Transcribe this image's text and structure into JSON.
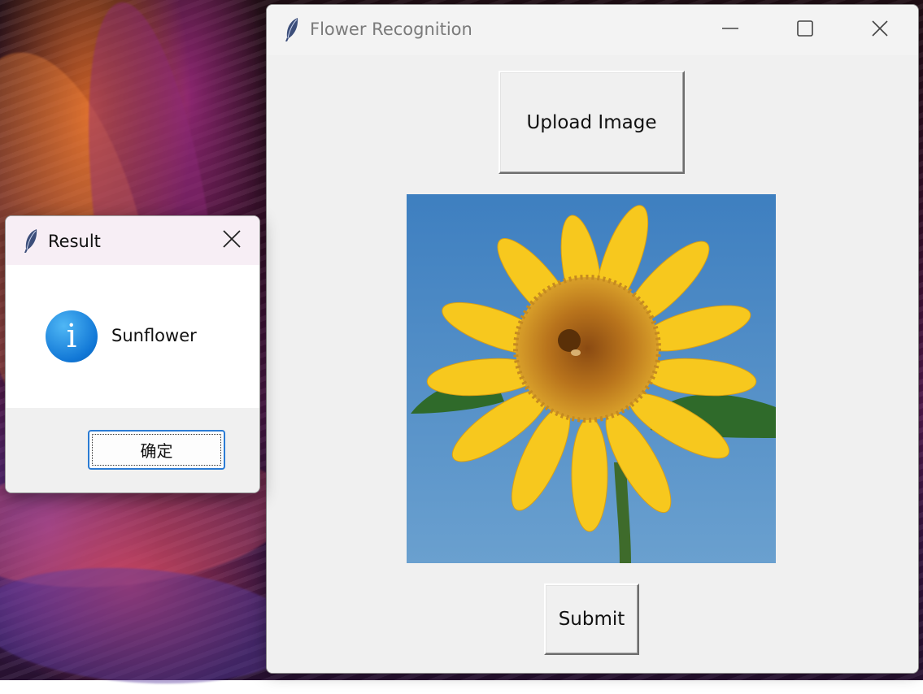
{
  "main_window": {
    "title": "Flower Recognition",
    "title_icon": "feather-icon",
    "controls": [
      "minimize-icon",
      "maximize-icon",
      "close-icon"
    ],
    "upload_label": "Upload Image",
    "submit_label": "Submit",
    "image_subject": "sunflower-photo"
  },
  "dialog": {
    "title": "Result",
    "title_icon": "feather-icon",
    "message": "Sunflower",
    "message_icon": "info-icon",
    "ok_label": "确定"
  },
  "colors": {
    "window_bg": "#f0f0f0",
    "dialog_title_bg": "#f7eef5",
    "focus_border": "#2a7bd4",
    "sky": "#4a8bc7",
    "petal": "#f7c81e"
  }
}
